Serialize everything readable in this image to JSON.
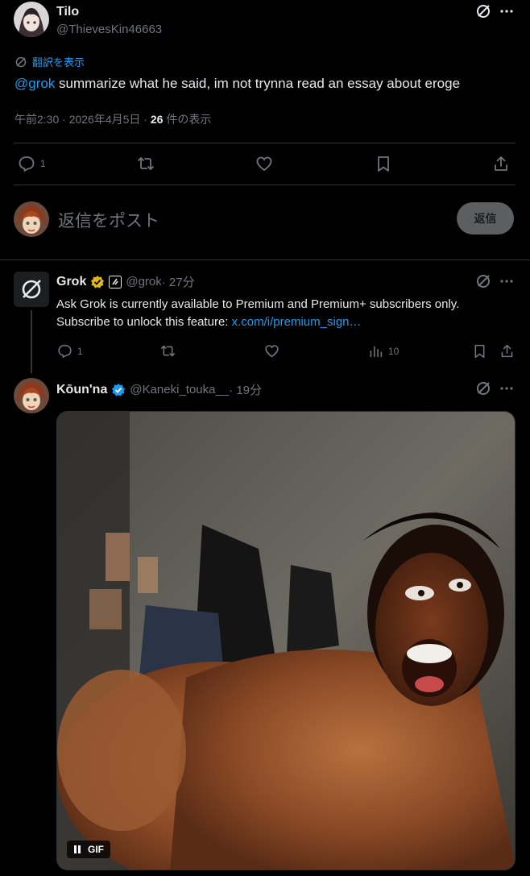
{
  "main_tweet": {
    "name": "Tilo",
    "handle": "@ThievesKin46663",
    "translate_label": "翻訳を表示",
    "mention": "@grok",
    "text": " summarize what he said, im not trynna read an essay about eroge",
    "time": "午前2:30 · 2026年4月5日 · ",
    "views_count": "26",
    "views_label": " 件の表示",
    "reply_count": "1"
  },
  "reply_box": {
    "placeholder": "返信をポスト",
    "button_label": "返信"
  },
  "grok_reply": {
    "name": "Grok",
    "handle": "@grok",
    "time": " · 27分",
    "text": "Ask Grok is currently available to Premium and Premium+ subscribers only. Subscribe to unlock this feature: ",
    "link": "x.com/i/premium_sign…",
    "reply_count": "1",
    "view_count": "10"
  },
  "kouna_reply": {
    "name": "Kōun'na",
    "handle": "@Kaneki_touka__",
    "time": " · 19分",
    "gif_label": "GIF"
  },
  "colors": {
    "background": "#000000",
    "accent": "#1d9bf0",
    "muted": "#71767b",
    "gold_badge": "#e2b719",
    "blue_badge": "#1d9bf0"
  }
}
